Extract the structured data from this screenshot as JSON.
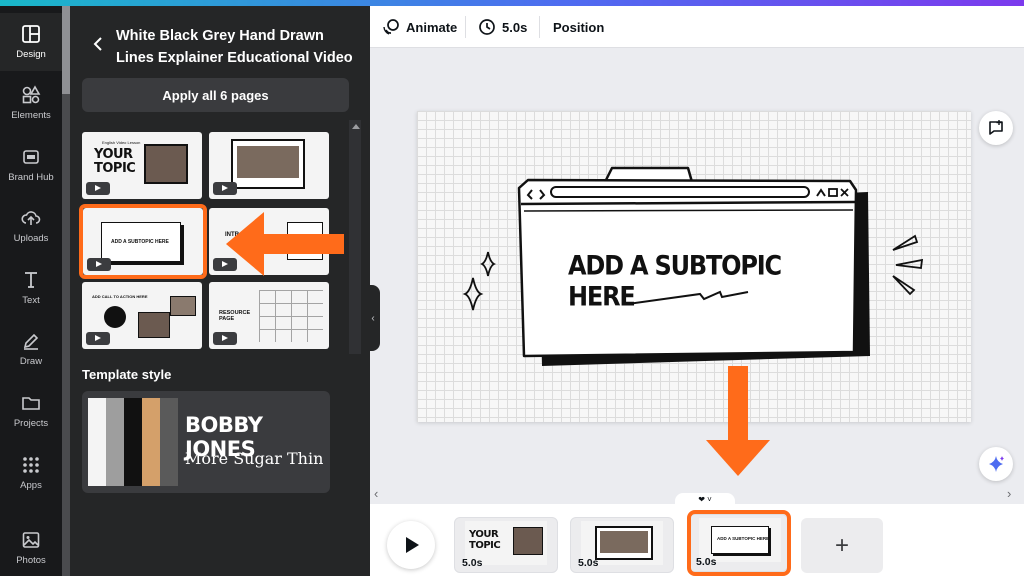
{
  "rail": {
    "items": [
      {
        "label": "Design",
        "icon": "layout-icon"
      },
      {
        "label": "Elements",
        "icon": "shapes-icon"
      },
      {
        "label": "Brand Hub",
        "icon": "brand-icon"
      },
      {
        "label": "Uploads",
        "icon": "cloud-upload-icon"
      },
      {
        "label": "Text",
        "icon": "text-icon"
      },
      {
        "label": "Draw",
        "icon": "pen-icon"
      },
      {
        "label": "Projects",
        "icon": "folder-icon"
      },
      {
        "label": "Apps",
        "icon": "grid-icon"
      },
      {
        "label": "Photos",
        "icon": "image-icon"
      }
    ]
  },
  "panel": {
    "title": "White Black Grey Hand Drawn Lines Explainer Educational Video",
    "apply_button": "Apply all 6 pages",
    "thumbs": [
      {
        "big": "YOUR TOPIC",
        "small": "English Video Lesson"
      },
      {
        "big": "",
        "small": ""
      },
      {
        "big": "",
        "small": "ADD A SUBTOPIC HERE"
      },
      {
        "big": "",
        "small": "INTR"
      },
      {
        "big": "",
        "small": "ADD CALL TO ACTION HERE"
      },
      {
        "big": "",
        "small": "RESOURCE PAGE"
      }
    ],
    "template_style_title": "Template style",
    "template_style": {
      "heading": "BOBBY JONES",
      "sub": "More Sugar Thin",
      "palette": [
        "#f4f4f4",
        "#9e9e9e",
        "#111111",
        "#d4a06a",
        "#5a5a5a"
      ]
    }
  },
  "toolbar": {
    "animate": "Animate",
    "duration": "5.0s",
    "position": "Position"
  },
  "canvas": {
    "subtopic": "ADD A SUBTOPIC HERE"
  },
  "timeline": {
    "pages": [
      {
        "duration": "5.0s",
        "big": "YOUR TOPIC"
      },
      {
        "duration": "5.0s",
        "big": ""
      },
      {
        "duration": "5.0s",
        "big": "ADD A SUBTOPIC HERE"
      }
    ],
    "add": "+"
  },
  "colors": {
    "highlight": "#ff6b1a",
    "rail_bg": "#18191b",
    "panel_bg": "#252627"
  }
}
